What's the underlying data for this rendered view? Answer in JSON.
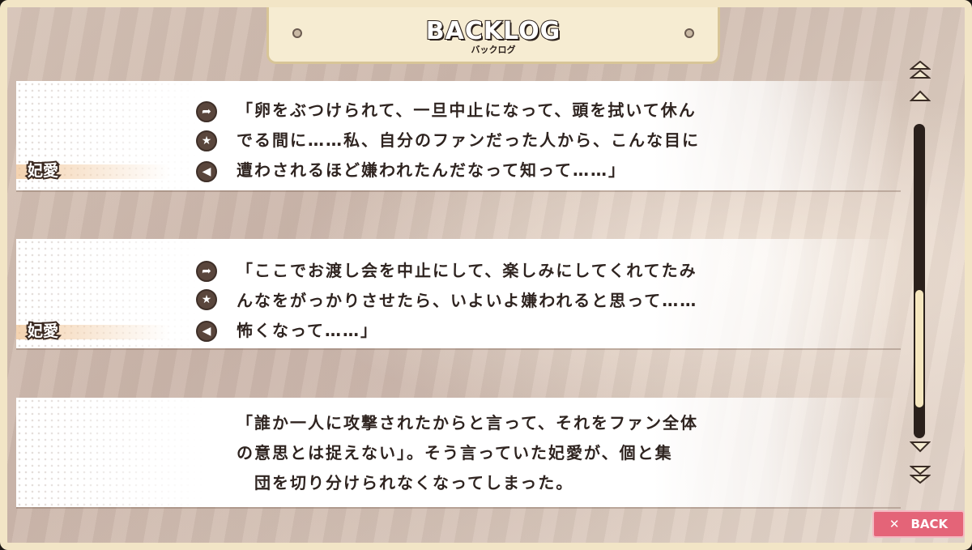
{
  "header": {
    "title": "BACKLOG",
    "subtitle": "バックログ"
  },
  "entries": [
    {
      "speaker": "妃愛",
      "lines": [
        "「卵をぶつけられて、一旦中止になって、頭を拭いて休ん",
        "でる間に……私、自分のファンだった人から、こんな目に",
        "遭わされるほど嫌われたんだなって知って……」"
      ],
      "icons": [
        "jump-icon",
        "favorite-star-icon",
        "voice-replay-icon"
      ]
    },
    {
      "speaker": "妃愛",
      "lines": [
        "「ここでお渡し会を中止にして、楽しみにしてくれてたみ",
        "んなをがっかりさせたら、いよいよ嫌われると思って……",
        "怖くなって……」"
      ],
      "icons": [
        "jump-icon",
        "favorite-star-icon",
        "voice-replay-icon"
      ]
    },
    {
      "speaker": "",
      "lines": [
        "「誰か一人に攻撃されたからと言って、それをファン全体",
        "の意思とは捉えない」。そう言っていた妃愛が、個と集",
        "団を切り分けられなくなってしまった。"
      ]
    }
  ],
  "icon_glyphs": {
    "jump": "➦",
    "star": "★",
    "voice": "◀"
  },
  "scrollbar": {
    "position": 0.85,
    "buttons": [
      "scroll-top-icon",
      "scroll-up-icon",
      "scroll-down-icon",
      "scroll-bottom-icon"
    ]
  },
  "back_button": {
    "icon": "✕",
    "label": "BACK"
  },
  "colors": {
    "frame": "#f2e5c6",
    "accent_back": "#e46478",
    "text": "#2f2420"
  }
}
